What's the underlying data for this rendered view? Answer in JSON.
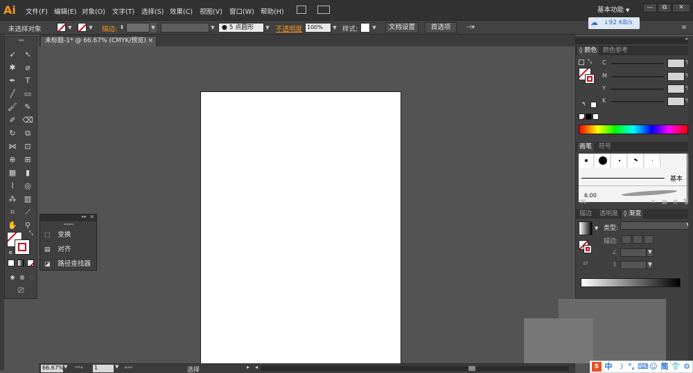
{
  "app": {
    "logo": "Ai",
    "menu": [
      "文件(F)",
      "编辑(E)",
      "对象(O)",
      "文字(T)",
      "选择(S)",
      "效果(C)",
      "视图(V)",
      "窗口(W)",
      "帮助(H)"
    ],
    "workspace": "基本功能",
    "window_buttons": [
      "—",
      "⧉",
      "✕"
    ],
    "accent_color": "#f7941d"
  },
  "speed_badge": {
    "text": "↓92 KB/s"
  },
  "control_bar": {
    "selection_status": "未选择对象",
    "stroke_label": "描边:",
    "brush_label": "5 点圆形",
    "opacity_label": "不透明度",
    "opacity_value": "100%",
    "style_label": "样式:",
    "doc_settings_button": "文档设置",
    "preferences_button": "首选项"
  },
  "document": {
    "tab_title": "未标题-1* @ 66.67% (CMYK/预览)",
    "tab_close": "×"
  },
  "float_panel": {
    "items": [
      "变换",
      "对齐",
      "路径查找器"
    ]
  },
  "color_panel": {
    "tabs": [
      "颜色",
      "颜色参考"
    ],
    "channels": [
      "C",
      "M",
      "Y",
      "K"
    ],
    "percent_sign": "%"
  },
  "brush_panel": {
    "tabs": [
      "画笔",
      "符号"
    ],
    "basic_label": "基本",
    "size_label": "6.00"
  },
  "gradient_panel": {
    "tabs": [
      "描边",
      "透明度",
      "渐变"
    ],
    "type_label": "类型:",
    "stroke_label": "描边:"
  },
  "status_bar": {
    "zoom": "66.67%",
    "page": "1",
    "mode": "选择"
  },
  "ime": {
    "items": [
      "中",
      "简"
    ]
  }
}
